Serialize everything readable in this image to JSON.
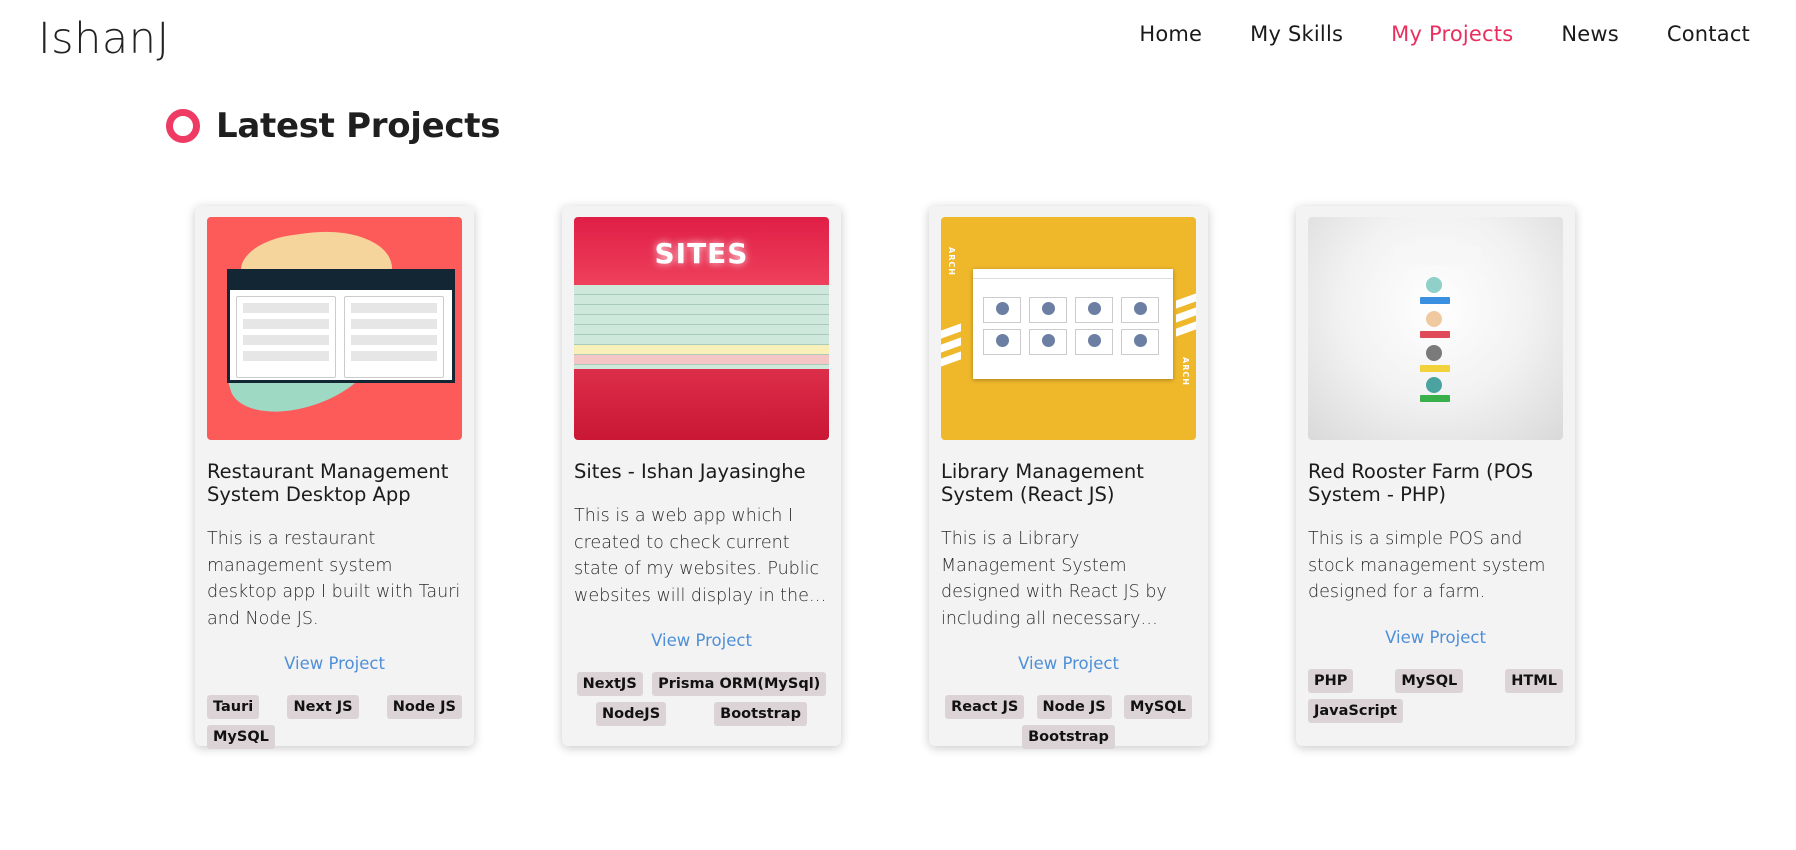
{
  "header": {
    "logo": "IshanJ",
    "nav": [
      {
        "label": "Home",
        "active": false
      },
      {
        "label": "My Skills",
        "active": false
      },
      {
        "label": "My Projects",
        "active": true
      },
      {
        "label": "News",
        "active": false
      },
      {
        "label": "Contact",
        "active": false
      }
    ]
  },
  "section": {
    "title": "Latest Projects",
    "accent_color": "#ef3a64"
  },
  "projects": [
    {
      "title": "Restaurant Management System Desktop App",
      "description": "This is a restaurant management system desktop app I built with Tauri and Node JS.",
      "link_label": "View Project",
      "tags": [
        "Tauri",
        "Next JS",
        "Node JS",
        "MySQL"
      ],
      "thumbnail_icon": "restaurant-app-screenshot"
    },
    {
      "title": "Sites - Ishan Jayasinghe",
      "description": "This is a web app which I created to check current state of my websites. Public websites will display in the list.",
      "link_label": "View Project",
      "tags": [
        "NextJS",
        "Prisma ORM(MySql)",
        "NodeJS",
        "Bootstrap"
      ],
      "thumbnail_text": "SITES",
      "thumbnail_icon": "sites-app-screenshot"
    },
    {
      "title": "Library Management System (React JS)",
      "description": "This is a Library Management System designed with React JS by including all necessary features.",
      "link_label": "View Project",
      "tags": [
        "React JS",
        "Node JS",
        "MySQL",
        "Bootstrap"
      ],
      "thumbnail_icon": "library-app-screenshot"
    },
    {
      "title": "Red Rooster Farm (POS System - PHP)",
      "description": "This is a simple POS and stock management system designed for a farm.",
      "link_label": "View Project",
      "tags": [
        "PHP",
        "MySQL",
        "HTML",
        "JavaScript"
      ],
      "thumbnail_icon": "pos-app-screenshot"
    }
  ],
  "colors": {
    "nav_active": "#e8305f",
    "link": "#4f8fd8",
    "tag_bg": "#dcd3d6",
    "card_bg": "#f3f3f3"
  }
}
